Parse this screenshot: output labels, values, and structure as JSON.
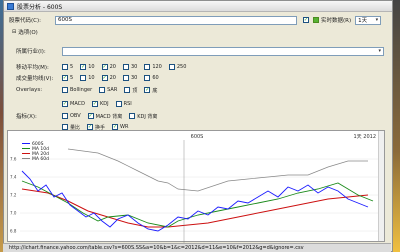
{
  "window": {
    "title": "股票分析 - 600S"
  },
  "form": {
    "code_label": "股票代码(C):",
    "code_value": "600S",
    "realtime_label": "实时数据(R)",
    "period_value": "1天",
    "section_label": "选项(O)",
    "industry_label": "所属行业(I):",
    "industry_value": "",
    "ma_label": "移动平均(M):",
    "ma_options": [
      {
        "label": "5",
        "checked": false
      },
      {
        "label": "10",
        "checked": true
      },
      {
        "label": "20",
        "checked": true
      },
      {
        "label": "30",
        "checked": false
      },
      {
        "label": "120",
        "checked": false
      },
      {
        "label": "250",
        "checked": false
      }
    ],
    "vol_label": "成交量均线(V):",
    "vol_options": [
      {
        "label": "5",
        "checked": true
      },
      {
        "label": "10",
        "checked": false
      },
      {
        "label": "20",
        "checked": true
      },
      {
        "label": "30",
        "checked": false
      },
      {
        "label": "60",
        "checked": false
      }
    ],
    "overlays_label": "Overlays:",
    "overlay_options": [
      {
        "label": "Bollinger",
        "checked": false
      },
      {
        "label": "SAR",
        "checked": false
      },
      {
        "label": "顶",
        "checked": false
      },
      {
        "label": "底",
        "checked": true
      }
    ],
    "indicators_row1": [
      {
        "label": "MACD",
        "checked": true
      },
      {
        "label": "KDJ",
        "checked": true
      },
      {
        "label": "RSI",
        "checked": false
      }
    ],
    "indicators_label": "指标(X):",
    "indicators_row2": [
      {
        "label": "OBV",
        "checked": false
      },
      {
        "label": "MACD 背离",
        "checked": true
      },
      {
        "label": "KDJ 背离",
        "checked": false
      }
    ],
    "indicators_row3": [
      {
        "label": "量比",
        "checked": false
      },
      {
        "label": "换手",
        "checked": true
      },
      {
        "label": "WR",
        "checked": true
      }
    ]
  },
  "chart": {
    "title": "600S",
    "right_label": "1天 2012",
    "legend": [
      "600S",
      "MA 10d",
      "MA 20d",
      "MA 60d"
    ],
    "y_ticks": [
      "7.6",
      "7.4",
      "7.2",
      "7.0",
      "6.8"
    ],
    "colors": {
      "price": "#1c1cff",
      "ma10": "#1a8a1a",
      "ma20": "#cc1010",
      "ma60": "#888888"
    }
  },
  "status": {
    "text": "http://ichart.finance.yahoo.com/table.csv?s=600S.SS&a=10&b=1&c=2012&d=11&e=10&f=2012&g=d&ignore=.csv"
  }
}
